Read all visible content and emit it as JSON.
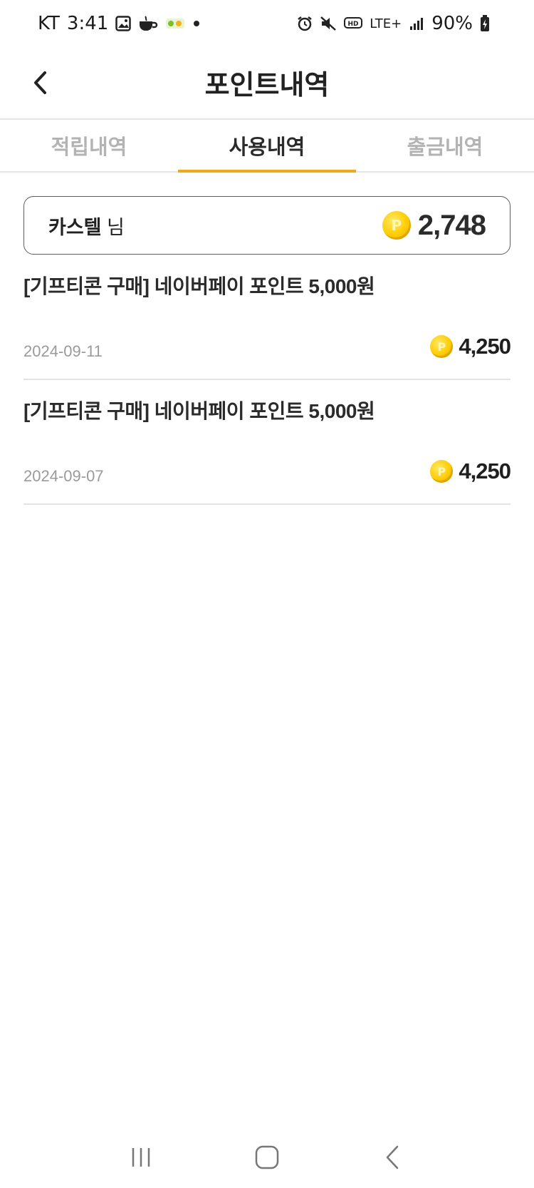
{
  "status_bar": {
    "carrier": "KT",
    "time": "3:41",
    "network": "LTE+",
    "battery": "90%"
  },
  "header": {
    "title": "포인트내역"
  },
  "tabs": [
    {
      "label": "적립내역",
      "active": false
    },
    {
      "label": "사용내역",
      "active": true
    },
    {
      "label": "출금내역",
      "active": false
    }
  ],
  "summary": {
    "user_name": "카스텔",
    "honorific": "님",
    "balance": "2,748"
  },
  "transactions": [
    {
      "title": "[기프티콘 구매] 네이버페이 포인트 5,000원",
      "date": "2024-09-11",
      "amount": "4,250"
    },
    {
      "title": "[기프티콘 구매] 네이버페이 포인트 5,000원",
      "date": "2024-09-07",
      "amount": "4,250"
    }
  ],
  "colors": {
    "accent": "#f1a91c",
    "coin": "#ffcc00"
  },
  "icons": {
    "coin_label": "P"
  }
}
